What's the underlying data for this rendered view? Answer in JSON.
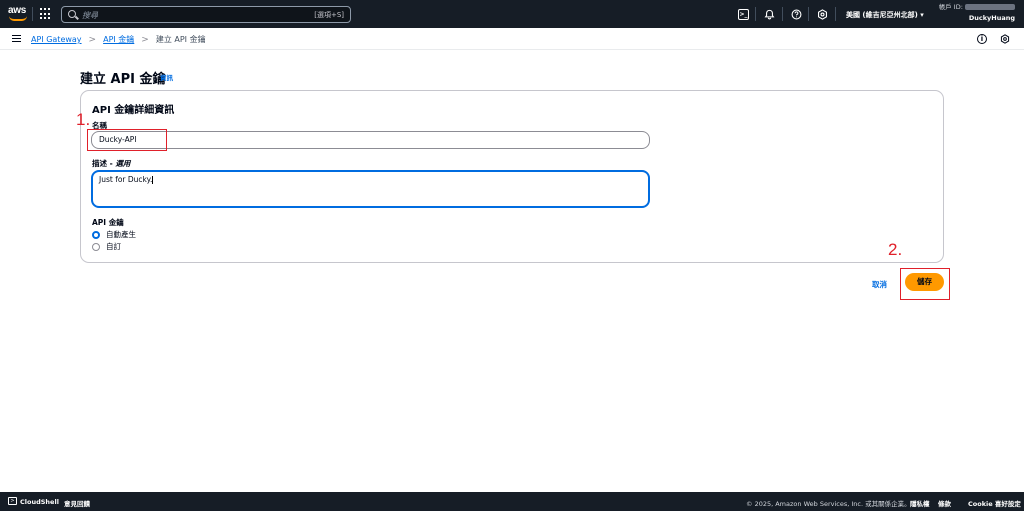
{
  "topnav": {
    "logo_text": "aws",
    "search_placeholder": "搜尋",
    "search_shortcut": "[選項+S]",
    "terminal_glyph": ">_",
    "region_label": "美國 (維吉尼亞州北部) ▾",
    "account_label": "帳戶 ID:",
    "username": "DuckyHuang",
    "icons": [
      "apps-grid-icon",
      "search-icon",
      "cloudshell-icon",
      "bell-icon",
      "help-icon",
      "gear-icon"
    ]
  },
  "breadcrumb": {
    "items": [
      "API Gateway",
      "API 金鑰",
      "建立 API 金鑰"
    ],
    "separator": ">"
  },
  "page": {
    "title": "建立 API 金鑰",
    "info_link": "資訊"
  },
  "form": {
    "card_title": "API 金鑰詳細資訊",
    "name_label": "名稱",
    "name_value": "Ducky-API",
    "description_label": "描述 - ",
    "description_optional": "選用",
    "description_value": "Just for Ducky.",
    "api_key_label": "API 金鑰",
    "radio_options": [
      {
        "label": "自動產生",
        "checked": true
      },
      {
        "label": "自訂",
        "checked": false
      }
    ]
  },
  "actions": {
    "cancel_label": "取消",
    "save_label": "儲存"
  },
  "annotations": {
    "step1": "1.",
    "step2": "2.",
    "color": "#e0202a"
  },
  "footer": {
    "cloudshell_label": "CloudShell",
    "feedback_label": "意見回饋",
    "copyright": "© 2025, Amazon Web Services, Inc. 或其關係企業。",
    "privacy_label": "隱私權",
    "terms_label": "條款",
    "cookie_label": "Cookie 喜好設定"
  },
  "colors": {
    "nav_bg": "#161d26",
    "link": "#006ce0",
    "primary_button": "#ff9900"
  }
}
